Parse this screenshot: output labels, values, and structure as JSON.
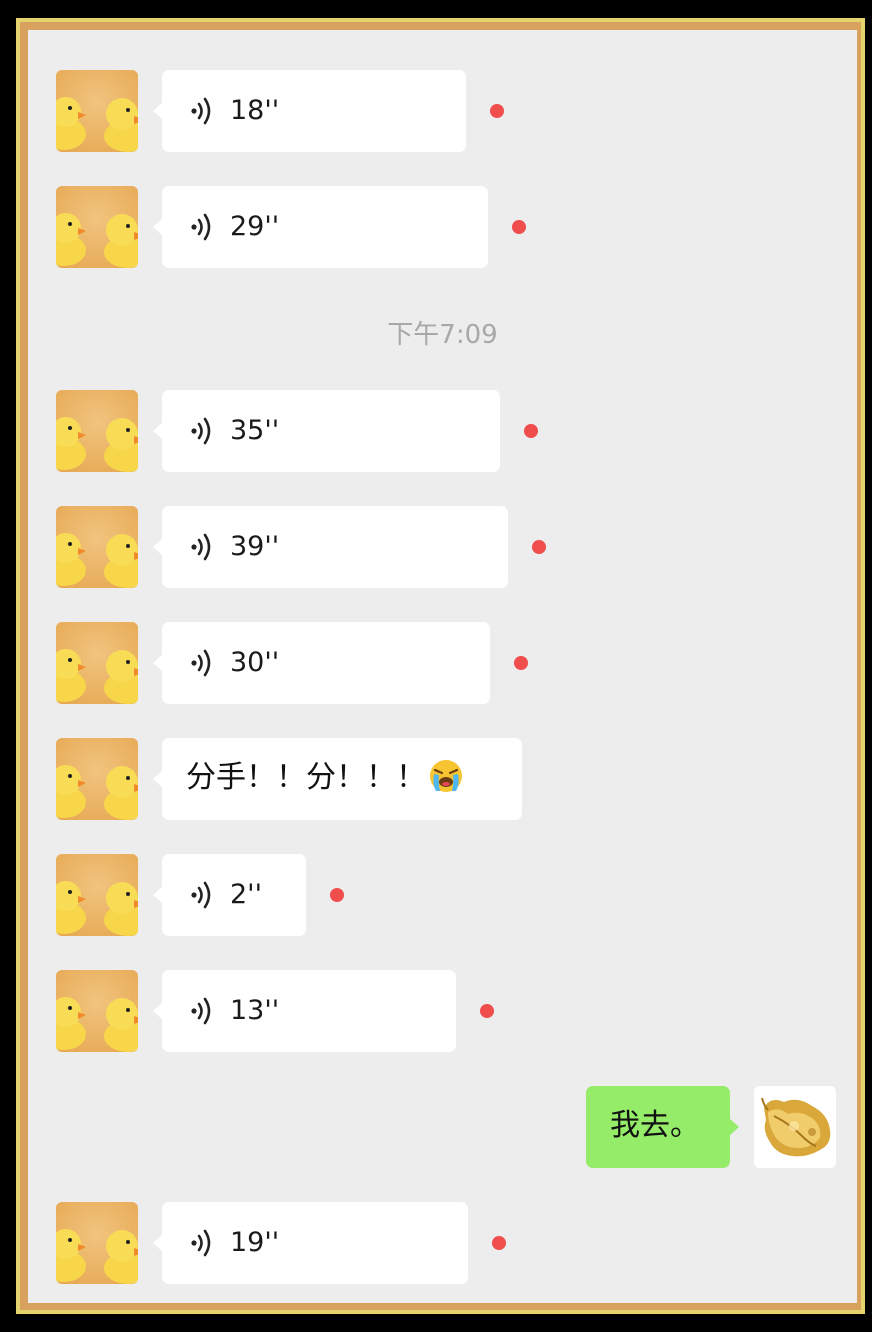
{
  "timestamp": "下午7:09",
  "messages_a": [
    {
      "duration": "18''"
    },
    {
      "duration": "29''"
    }
  ],
  "messages_b": [
    {
      "duration": "35''"
    },
    {
      "duration": "39''"
    },
    {
      "duration": "30''"
    }
  ],
  "text_message": {
    "text": "分手！！分！！！",
    "emoji": "loudly-crying-face-icon"
  },
  "messages_c": [
    {
      "duration": "2''"
    },
    {
      "duration": "13''"
    }
  ],
  "own_message": {
    "text": "我去。"
  },
  "last_voice": {
    "duration": "19''"
  },
  "colors": {
    "background": "#ededed",
    "bubble_other": "#ffffff",
    "bubble_self": "#95ec69",
    "unread_dot": "#f04d4d",
    "timestamp": "#a8a8a8",
    "frame": "#d8a25e"
  },
  "icons": {
    "voice": "voice-wave-icon",
    "avatar_contact": "rubber-duck-avatar",
    "avatar_self": "golden-leaf-avatar"
  }
}
